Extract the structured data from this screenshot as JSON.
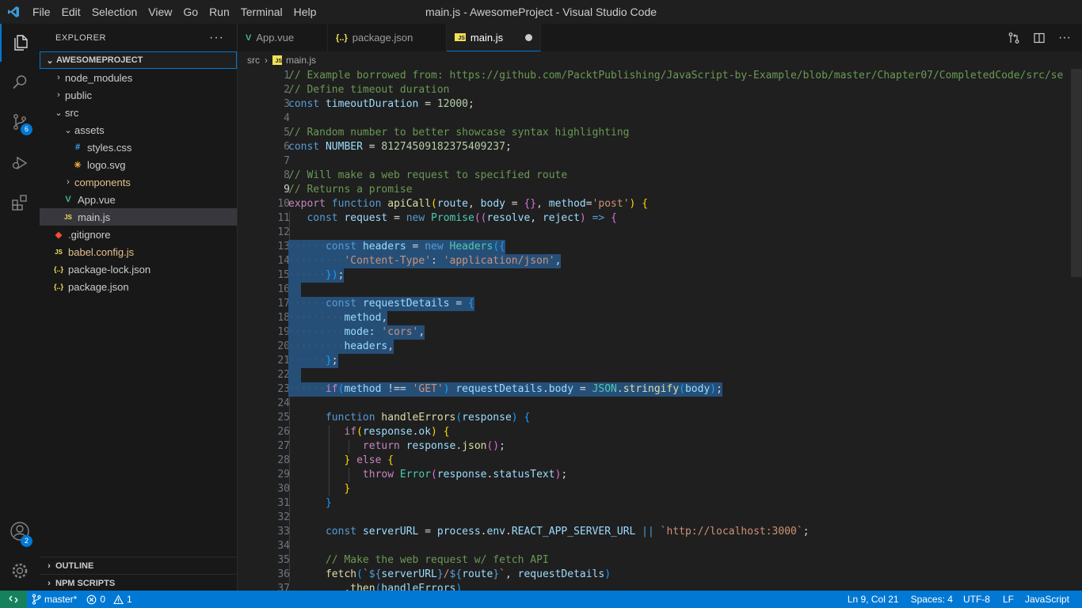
{
  "window": {
    "title": "main.js - AwesomeProject - Visual Studio Code"
  },
  "menu": [
    "File",
    "Edit",
    "Selection",
    "View",
    "Go",
    "Run",
    "Terminal",
    "Help"
  ],
  "activity": {
    "source_control_badge": "6",
    "accounts_badge": "2"
  },
  "sidebar": {
    "title": "EXPLORER",
    "more": "···",
    "project": "AWESOMEPROJECT",
    "tree": [
      {
        "label": "node_modules",
        "indent": 1,
        "kind": "folder-closed",
        "icon_color": "#cccccc"
      },
      {
        "label": "public",
        "indent": 1,
        "kind": "folder-closed",
        "icon_color": "#cccccc"
      },
      {
        "label": "src",
        "indent": 1,
        "kind": "folder-open",
        "icon_color": "#cccccc"
      },
      {
        "label": "assets",
        "indent": 2,
        "kind": "folder-open",
        "icon_color": "#cccccc"
      },
      {
        "label": "styles.css",
        "indent": 3,
        "kind": "file",
        "icon": "css-icon",
        "icon_color": "#42a5f5"
      },
      {
        "label": "logo.svg",
        "indent": 3,
        "kind": "file",
        "icon": "svg-icon",
        "icon_color": "#ffb13b"
      },
      {
        "label": "components",
        "indent": 2,
        "kind": "folder-closed",
        "icon_color": "#e2c08d"
      },
      {
        "label": "App.vue",
        "indent": 2,
        "kind": "file",
        "icon": "vue-icon",
        "icon_color": "#41b883"
      },
      {
        "label": "main.js",
        "indent": 2,
        "kind": "file",
        "icon": "js-icon",
        "icon_color": "#f1e05a",
        "selected": true
      },
      {
        "label": ".gitignore",
        "indent": 1,
        "kind": "file",
        "icon": "git-icon",
        "icon_color": "#f14e32"
      },
      {
        "label": "babel.config.js",
        "indent": 1,
        "kind": "file",
        "icon": "js-icon",
        "icon_color": "#f1e05a",
        "label_color": "#e2c08d"
      },
      {
        "label": "package-lock.json",
        "indent": 1,
        "kind": "file",
        "icon": "json-icon",
        "icon_color": "#f1e05a"
      },
      {
        "label": "package.json",
        "indent": 1,
        "kind": "file",
        "icon": "json-icon",
        "icon_color": "#f1e05a"
      }
    ],
    "outline": "OUTLINE",
    "npm_scripts": "NPM SCRIPTS"
  },
  "tabs": [
    {
      "label": "App.vue",
      "icon": "vue-icon",
      "glyph": "V",
      "icon_color": "#41b883"
    },
    {
      "label": "package.json",
      "icon": "json-icon",
      "glyph": "{..}",
      "icon_color": "#f1e05a"
    },
    {
      "label": "main.js",
      "icon": "js-icon",
      "glyph": "JS",
      "icon_color": "#f1e05a",
      "active": true,
      "dirty": true
    }
  ],
  "breadcrumb": {
    "folder": "src",
    "file": "main.js"
  },
  "editor": {
    "current_line": 9,
    "lines": [
      {
        "n": 1,
        "t": [
          [
            "c-com",
            "// Example borrowed from: https://github.com/PacktPublishing/JavaScript-by-Example/blob/master/Chapter07/CompletedCode/src/se"
          ]
        ]
      },
      {
        "n": 2,
        "t": [
          [
            "c-com",
            "// Define timeout duration"
          ]
        ]
      },
      {
        "n": 3,
        "t": [
          [
            "c-dec",
            "const "
          ],
          [
            "c-var",
            "timeoutDuration"
          ],
          [
            "c-txt",
            " = "
          ],
          [
            "c-num",
            "12000"
          ],
          [
            "c-txt",
            ";"
          ]
        ]
      },
      {
        "n": 4,
        "t": []
      },
      {
        "n": 5,
        "t": [
          [
            "c-com",
            "// Random number to better showcase syntax highlighting"
          ]
        ]
      },
      {
        "n": 6,
        "t": [
          [
            "c-dec",
            "const "
          ],
          [
            "c-var",
            "NUMBER"
          ],
          [
            "c-txt",
            " = "
          ],
          [
            "c-num",
            "81274509182375409237"
          ],
          [
            "c-txt",
            ";"
          ]
        ]
      },
      {
        "n": 7,
        "t": []
      },
      {
        "n": 8,
        "t": [
          [
            "c-com",
            "// Will make a web request to specified route"
          ]
        ]
      },
      {
        "n": 9,
        "t": [
          [
            "c-com",
            "// Returns a promise"
          ]
        ]
      },
      {
        "n": 10,
        "t": [
          [
            "c-kw",
            "export "
          ],
          [
            "c-dec",
            "function "
          ],
          [
            "c-fn",
            "apiCall"
          ],
          [
            "c-br1",
            "("
          ],
          [
            "c-var",
            "route"
          ],
          [
            "c-txt",
            ", "
          ],
          [
            "c-var",
            "body"
          ],
          [
            "c-txt",
            " = "
          ],
          [
            "c-br2",
            "{}"
          ],
          [
            "c-txt",
            ", "
          ],
          [
            "c-var",
            "method"
          ],
          [
            "c-txt",
            "="
          ],
          [
            "c-str",
            "'post'"
          ],
          [
            "c-br1",
            ")"
          ],
          [
            "c-txt",
            " "
          ],
          [
            "c-br1",
            "{"
          ]
        ]
      },
      {
        "n": 11,
        "t": [
          [
            "c-txt",
            "   "
          ],
          [
            "c-dec",
            "const "
          ],
          [
            "c-var",
            "request"
          ],
          [
            "c-txt",
            " = "
          ],
          [
            "c-dec",
            "new "
          ],
          [
            "c-cls",
            "Promise"
          ],
          [
            "c-br2",
            "(("
          ],
          [
            "c-var",
            "resolve"
          ],
          [
            "c-txt",
            ", "
          ],
          [
            "c-var",
            "reject"
          ],
          [
            "c-br2",
            ")"
          ],
          [
            "c-dec",
            " => "
          ],
          [
            "c-br2",
            "{"
          ]
        ]
      },
      {
        "n": 12,
        "t": []
      },
      {
        "n": 13,
        "sel": true,
        "t": [
          [
            "ws",
            "······"
          ],
          [
            "c-dec",
            "const "
          ],
          [
            "c-var",
            "headers"
          ],
          [
            "c-txt",
            " = "
          ],
          [
            "c-dec",
            "new "
          ],
          [
            "c-cls",
            "Headers"
          ],
          [
            "c-br3",
            "({"
          ]
        ]
      },
      {
        "n": 14,
        "sel": true,
        "t": [
          [
            "ws",
            "·········"
          ],
          [
            "c-str",
            "'Content-Type'"
          ],
          [
            "c-txt",
            ": "
          ],
          [
            "c-str",
            "'application/json'"
          ],
          [
            "c-txt",
            ","
          ]
        ]
      },
      {
        "n": 15,
        "sel": true,
        "t": [
          [
            "ws",
            "······"
          ],
          [
            "c-br3",
            "})"
          ],
          [
            "c-txt",
            ";"
          ]
        ]
      },
      {
        "n": 16,
        "sel": true,
        "t": [
          [
            "ws",
            "  "
          ]
        ]
      },
      {
        "n": 17,
        "sel": true,
        "t": [
          [
            "ws",
            "······"
          ],
          [
            "c-dec",
            "const "
          ],
          [
            "c-var",
            "requestDetails"
          ],
          [
            "c-txt",
            " = "
          ],
          [
            "c-br3",
            "{"
          ]
        ]
      },
      {
        "n": 18,
        "sel": true,
        "t": [
          [
            "ws",
            "·········"
          ],
          [
            "c-var",
            "method"
          ],
          [
            "c-txt",
            ","
          ]
        ]
      },
      {
        "n": 19,
        "sel": true,
        "t": [
          [
            "ws",
            "·········"
          ],
          [
            "c-var",
            "mode"
          ],
          [
            "c-txt",
            ": "
          ],
          [
            "c-str",
            "'cors'"
          ],
          [
            "c-txt",
            ","
          ]
        ]
      },
      {
        "n": 20,
        "sel": true,
        "t": [
          [
            "ws",
            "·········"
          ],
          [
            "c-var",
            "headers"
          ],
          [
            "c-txt",
            ","
          ]
        ]
      },
      {
        "n": 21,
        "sel": true,
        "t": [
          [
            "ws",
            "······"
          ],
          [
            "c-br3",
            "}"
          ],
          [
            "c-txt",
            ";"
          ]
        ]
      },
      {
        "n": 22,
        "sel": true,
        "t": [
          [
            "ws",
            "  "
          ]
        ]
      },
      {
        "n": 23,
        "sel": true,
        "t": [
          [
            "ws",
            "······"
          ],
          [
            "c-kw",
            "if"
          ],
          [
            "c-br3",
            "("
          ],
          [
            "c-var",
            "method"
          ],
          [
            "c-txt",
            " !== "
          ],
          [
            "c-str",
            "'GET'"
          ],
          [
            "c-br3",
            ")"
          ],
          [
            "c-txt",
            " "
          ],
          [
            "c-var",
            "requestDetails"
          ],
          [
            "c-txt",
            "."
          ],
          [
            "c-var",
            "body"
          ],
          [
            "c-txt",
            " = "
          ],
          [
            "c-cls",
            "JSON"
          ],
          [
            "c-txt",
            "."
          ],
          [
            "c-fn",
            "stringify"
          ],
          [
            "c-br3",
            "("
          ],
          [
            "c-var",
            "body"
          ],
          [
            "c-br3",
            ")"
          ],
          [
            "c-txt",
            ";"
          ]
        ]
      },
      {
        "n": 24,
        "t": []
      },
      {
        "n": 25,
        "t": [
          [
            "c-txt",
            "      "
          ],
          [
            "c-dec",
            "function "
          ],
          [
            "c-fn",
            "handleErrors"
          ],
          [
            "c-br3",
            "("
          ],
          [
            "c-var",
            "response"
          ],
          [
            "c-br3",
            ")"
          ],
          [
            "c-txt",
            " "
          ],
          [
            "c-br3",
            "{"
          ]
        ]
      },
      {
        "n": 26,
        "t": [
          [
            "c-txt",
            "         "
          ],
          [
            "c-kw",
            "if"
          ],
          [
            "c-br1",
            "("
          ],
          [
            "c-var",
            "response"
          ],
          [
            "c-txt",
            "."
          ],
          [
            "c-var",
            "ok"
          ],
          [
            "c-br1",
            ")"
          ],
          [
            "c-txt",
            " "
          ],
          [
            "c-br1",
            "{"
          ]
        ]
      },
      {
        "n": 27,
        "t": [
          [
            "c-txt",
            "            "
          ],
          [
            "c-kw",
            "return "
          ],
          [
            "c-var",
            "response"
          ],
          [
            "c-txt",
            "."
          ],
          [
            "c-fn",
            "json"
          ],
          [
            "c-br2",
            "()"
          ],
          [
            "c-txt",
            ";"
          ]
        ]
      },
      {
        "n": 28,
        "t": [
          [
            "c-txt",
            "         "
          ],
          [
            "c-br1",
            "}"
          ],
          [
            "c-kw",
            " else "
          ],
          [
            "c-br1",
            "{"
          ]
        ]
      },
      {
        "n": 29,
        "t": [
          [
            "c-txt",
            "            "
          ],
          [
            "c-kw",
            "throw "
          ],
          [
            "c-cls",
            "Error"
          ],
          [
            "c-br2",
            "("
          ],
          [
            "c-var",
            "response"
          ],
          [
            "c-txt",
            "."
          ],
          [
            "c-var",
            "statusText"
          ],
          [
            "c-br2",
            ")"
          ],
          [
            "c-txt",
            ";"
          ]
        ]
      },
      {
        "n": 30,
        "t": [
          [
            "c-txt",
            "         "
          ],
          [
            "c-br1",
            "}"
          ]
        ]
      },
      {
        "n": 31,
        "t": [
          [
            "c-txt",
            "      "
          ],
          [
            "c-br3",
            "}"
          ]
        ]
      },
      {
        "n": 32,
        "t": []
      },
      {
        "n": 33,
        "t": [
          [
            "c-txt",
            "      "
          ],
          [
            "c-dec",
            "const "
          ],
          [
            "c-var",
            "serverURL"
          ],
          [
            "c-txt",
            " = "
          ],
          [
            "c-var",
            "process"
          ],
          [
            "c-txt",
            "."
          ],
          [
            "c-var",
            "env"
          ],
          [
            "c-txt",
            "."
          ],
          [
            "c-var",
            "REACT_APP_SERVER_URL"
          ],
          [
            "c-dec",
            " || "
          ],
          [
            "c-str",
            "`http://localhost:3000`"
          ],
          [
            "c-txt",
            ";"
          ]
        ]
      },
      {
        "n": 34,
        "t": []
      },
      {
        "n": 35,
        "t": [
          [
            "c-txt",
            "      "
          ],
          [
            "c-com",
            "// Make the web request w/ fetch API"
          ]
        ]
      },
      {
        "n": 36,
        "t": [
          [
            "c-txt",
            "      "
          ],
          [
            "c-fn",
            "fetch"
          ],
          [
            "c-br3",
            "("
          ],
          [
            "c-str",
            "`"
          ],
          [
            "c-dec",
            "${"
          ],
          [
            "c-var",
            "serverURL"
          ],
          [
            "c-dec",
            "}"
          ],
          [
            "c-str",
            "/"
          ],
          [
            "c-dec",
            "${"
          ],
          [
            "c-var",
            "route"
          ],
          [
            "c-dec",
            "}"
          ],
          [
            "c-str",
            "`"
          ],
          [
            "c-txt",
            ", "
          ],
          [
            "c-var",
            "requestDetails"
          ],
          [
            "c-br3",
            ")"
          ]
        ]
      },
      {
        "n": 37,
        "t": [
          [
            "c-txt",
            "         ."
          ],
          [
            "c-fn",
            "then"
          ],
          [
            "c-br3",
            "("
          ],
          [
            "c-var",
            "handleErrors"
          ],
          [
            "c-br3",
            ")"
          ]
        ]
      }
    ]
  },
  "status": {
    "branch": "master*",
    "errors": "0",
    "warnings": "1",
    "position": "Ln 9, Col 21",
    "spaces": "Spaces: 4",
    "encoding": "UTF-8",
    "eol": "LF",
    "language": "JavaScript"
  }
}
